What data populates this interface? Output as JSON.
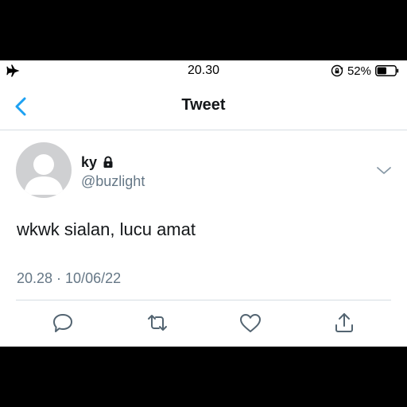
{
  "status_bar": {
    "time": "20.30",
    "battery_percent": "52%",
    "battery_level": 0.52,
    "icons": [
      "airplane-icon",
      "rotation-lock-icon",
      "battery-icon"
    ]
  },
  "nav": {
    "title": "Tweet",
    "back_icon": "chevron-left-icon"
  },
  "tweet": {
    "display_name": "ky",
    "protected_icon": "lock-icon",
    "handle": "@buzlight",
    "text": "wkwk sialan, lucu amat",
    "timestamp": "20.28 · 10/06/22",
    "more_icon": "chevron-down-icon"
  },
  "actions": [
    "reply-icon",
    "retweet-icon",
    "like-icon",
    "share-icon"
  ],
  "colors": {
    "accent": "#1da1f2",
    "text": "#14171a",
    "secondary": "#657786",
    "divider": "#d6dde3"
  }
}
